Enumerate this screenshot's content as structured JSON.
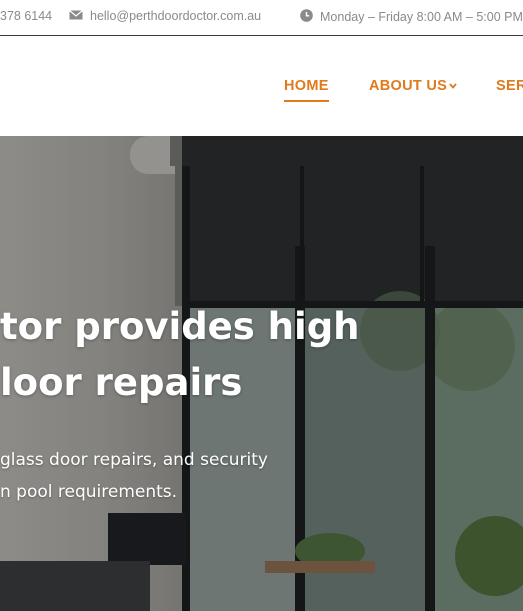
{
  "topbar": {
    "phone": "378 6144",
    "email": "hello@perthdoordoctor.com.au",
    "hours": "Monday – Friday 8:00 AM – 5:00 PM"
  },
  "nav": {
    "home": "HOME",
    "about": "ABOUT US",
    "services": "SER"
  },
  "hero": {
    "heading_line1": "tor provides high",
    "heading_line2": "loor repairs",
    "sub_line1": "glass door repairs, and security",
    "sub_line2": "n pool requirements."
  },
  "colors": {
    "accent": "#e07a1c",
    "topbar_text": "#8a8a8a"
  }
}
